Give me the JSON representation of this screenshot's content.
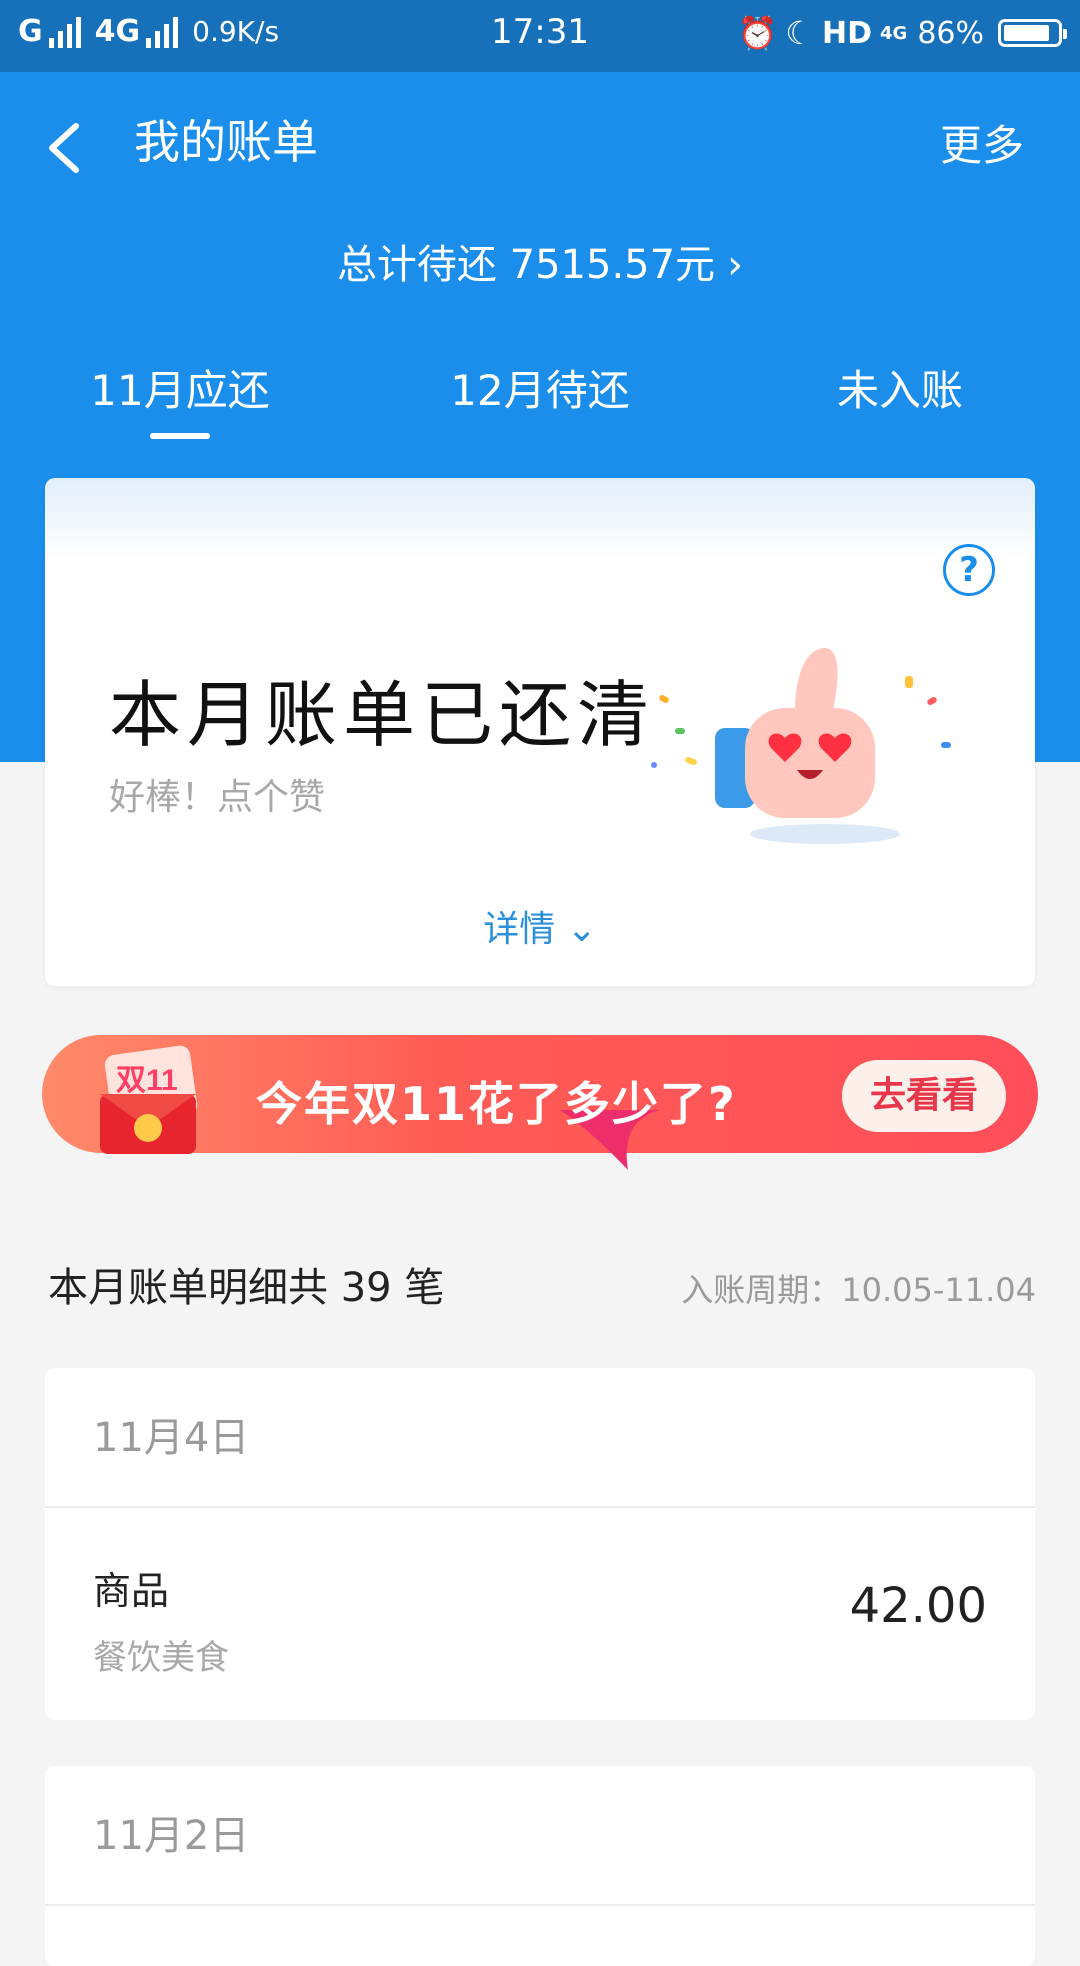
{
  "status_bar": {
    "carrier": "G",
    "network": "4G",
    "speed": "0.9K/s",
    "time": "17:31",
    "hd": "HD",
    "network2": "4G",
    "battery_text": "86%",
    "battery_level": 0.86
  },
  "header": {
    "title": "我的账单",
    "more": "更多",
    "total": "总计待还 7515.57元",
    "total_chevron": "›",
    "tabs": [
      {
        "label": "11月应还"
      },
      {
        "label": "12月待还"
      },
      {
        "label": "未入账"
      }
    ]
  },
  "status_card": {
    "help": "?",
    "title": "本月账单已还清",
    "subtitle": "好棒！点个赞",
    "detail": "详情 ⌄"
  },
  "banner": {
    "icon_text": "双11",
    "text": "今年双11花了多少了?",
    "button": "去看看"
  },
  "summary": {
    "count_text": "本月账单明细共 39 笔",
    "period": "入账周期：10.05-11.04"
  },
  "bills": [
    {
      "date": "11月4日",
      "name": "商品",
      "category": "餐饮美食",
      "amount": "42.00"
    },
    {
      "date": "11月2日"
    }
  ],
  "colors": {
    "header_blue": "#1a8eea",
    "statusbar_blue": "#1770ba",
    "banner_red": "#ff4e5a",
    "link_blue": "#2a90db"
  }
}
